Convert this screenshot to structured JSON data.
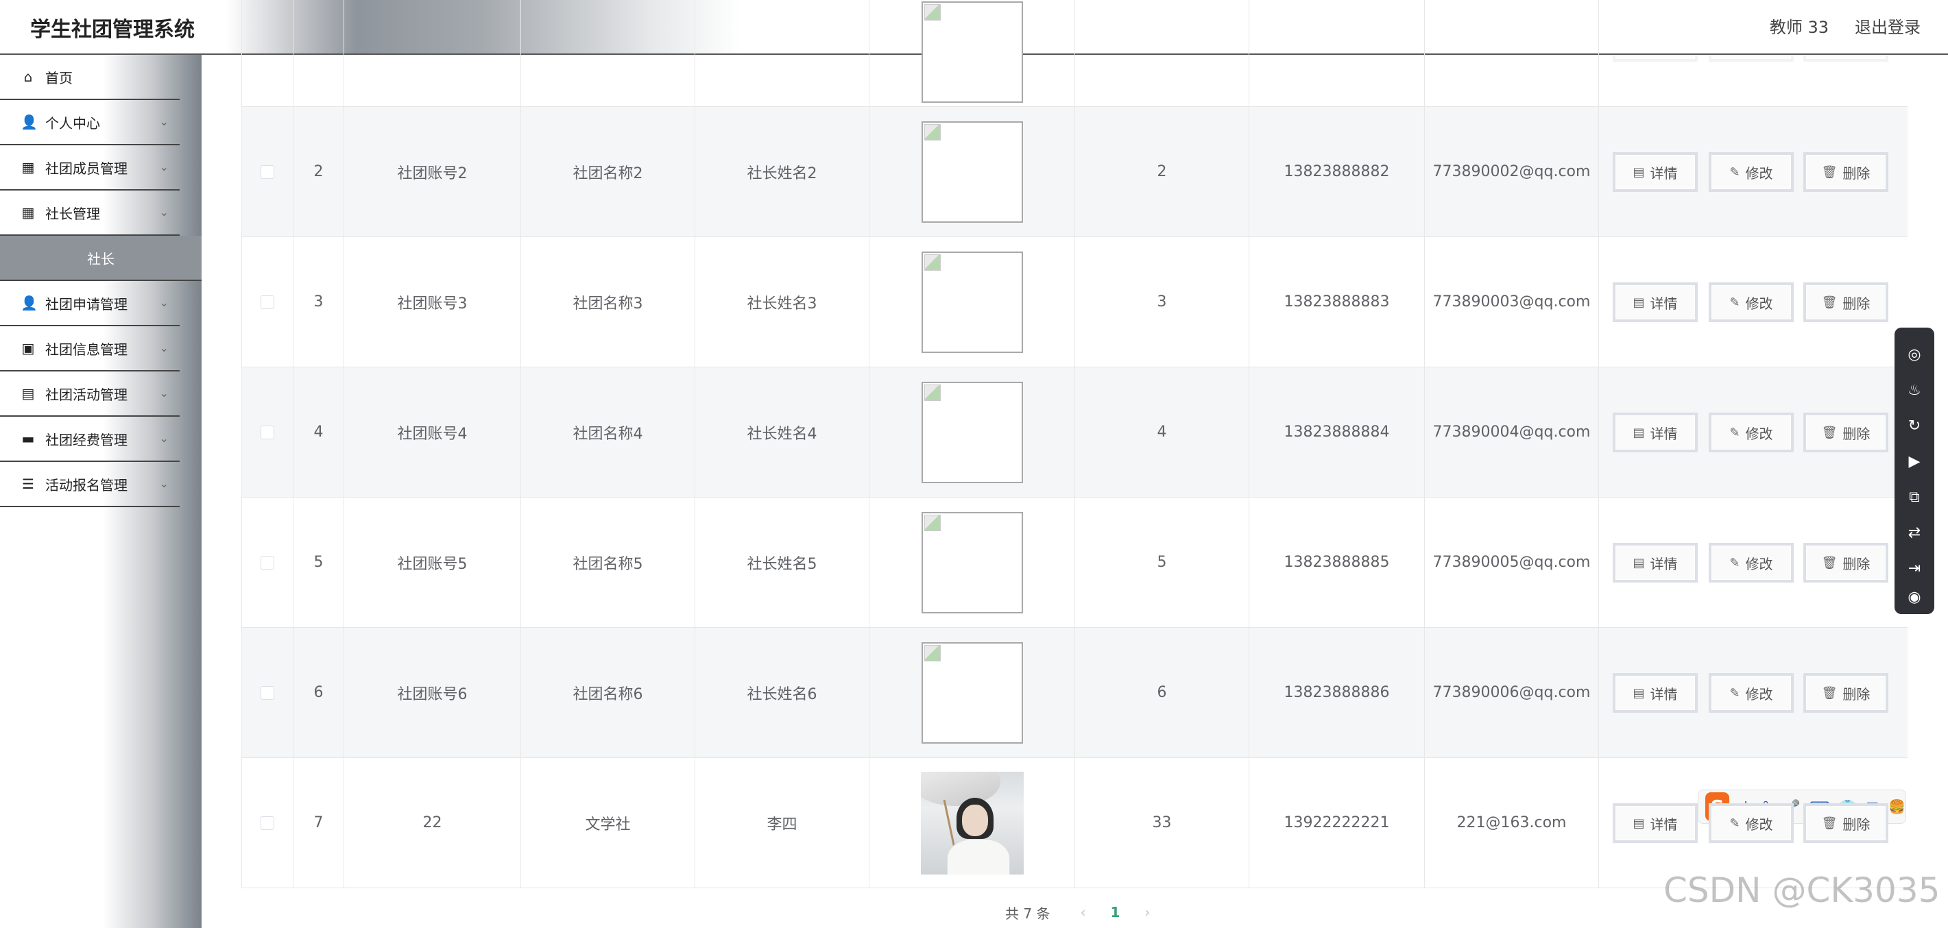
{
  "header": {
    "title": "学生社团管理系统",
    "user": "教师 33",
    "logout": "退出登录"
  },
  "sidebar": {
    "items": [
      {
        "label": "首页",
        "icon": "home-icon",
        "glyph": "⌂",
        "has_chevron": false
      },
      {
        "label": "个人中心",
        "icon": "user-icon",
        "glyph": "👤",
        "has_chevron": true
      },
      {
        "label": "社团成员管理",
        "icon": "grid-icon",
        "glyph": "▦",
        "has_chevron": true
      },
      {
        "label": "社长管理",
        "icon": "grid-icon",
        "glyph": "▦",
        "has_chevron": true
      }
    ],
    "submenu_label": "社长",
    "items_after": [
      {
        "label": "社团申请管理",
        "icon": "user-icon",
        "glyph": "👤",
        "has_chevron": true
      },
      {
        "label": "社团信息管理",
        "icon": "briefcase-icon",
        "glyph": "▣",
        "has_chevron": true
      },
      {
        "label": "社团活动管理",
        "icon": "case-icon",
        "glyph": "▤",
        "has_chevron": true
      },
      {
        "label": "社团经费管理",
        "icon": "chat-icon",
        "glyph": "▬",
        "has_chevron": true
      },
      {
        "label": "活动报名管理",
        "icon": "list-icon",
        "glyph": "☰",
        "has_chevron": true
      }
    ]
  },
  "table": {
    "rows": [
      {
        "idx": "2",
        "account": "社团账号2",
        "name": "社团名称2",
        "leader": "社长姓名2",
        "image": "broken",
        "num": "2",
        "phone": "13823888882",
        "email": "773890002@qq.com"
      },
      {
        "idx": "3",
        "account": "社团账号3",
        "name": "社团名称3",
        "leader": "社长姓名3",
        "image": "broken",
        "num": "3",
        "phone": "13823888883",
        "email": "773890003@qq.com"
      },
      {
        "idx": "4",
        "account": "社团账号4",
        "name": "社团名称4",
        "leader": "社长姓名4",
        "image": "broken",
        "num": "4",
        "phone": "13823888884",
        "email": "773890004@qq.com"
      },
      {
        "idx": "5",
        "account": "社团账号5",
        "name": "社团名称5",
        "leader": "社长姓名5",
        "image": "broken",
        "num": "5",
        "phone": "13823888885",
        "email": "773890005@qq.com"
      },
      {
        "idx": "6",
        "account": "社团账号6",
        "name": "社团名称6",
        "leader": "社长姓名6",
        "image": "broken",
        "num": "6",
        "phone": "13823888886",
        "email": "773890006@qq.com"
      },
      {
        "idx": "7",
        "account": "22",
        "name": "文学社",
        "leader": "李四",
        "image": "photo",
        "num": "33",
        "phone": "13922222221",
        "email": "221@163.com"
      }
    ],
    "actions": {
      "detail": "详情",
      "edit": "修改",
      "delete": "删除"
    }
  },
  "pagination": {
    "total": "共 7 条",
    "current": "1",
    "prev": "‹",
    "next": "›"
  },
  "ime": {
    "logo": "S",
    "mode": "中",
    "items": [
      "°,",
      "🎤",
      "⌨",
      "👕",
      "▦",
      "🍔"
    ]
  },
  "watermark": "CSDN @CK3035"
}
